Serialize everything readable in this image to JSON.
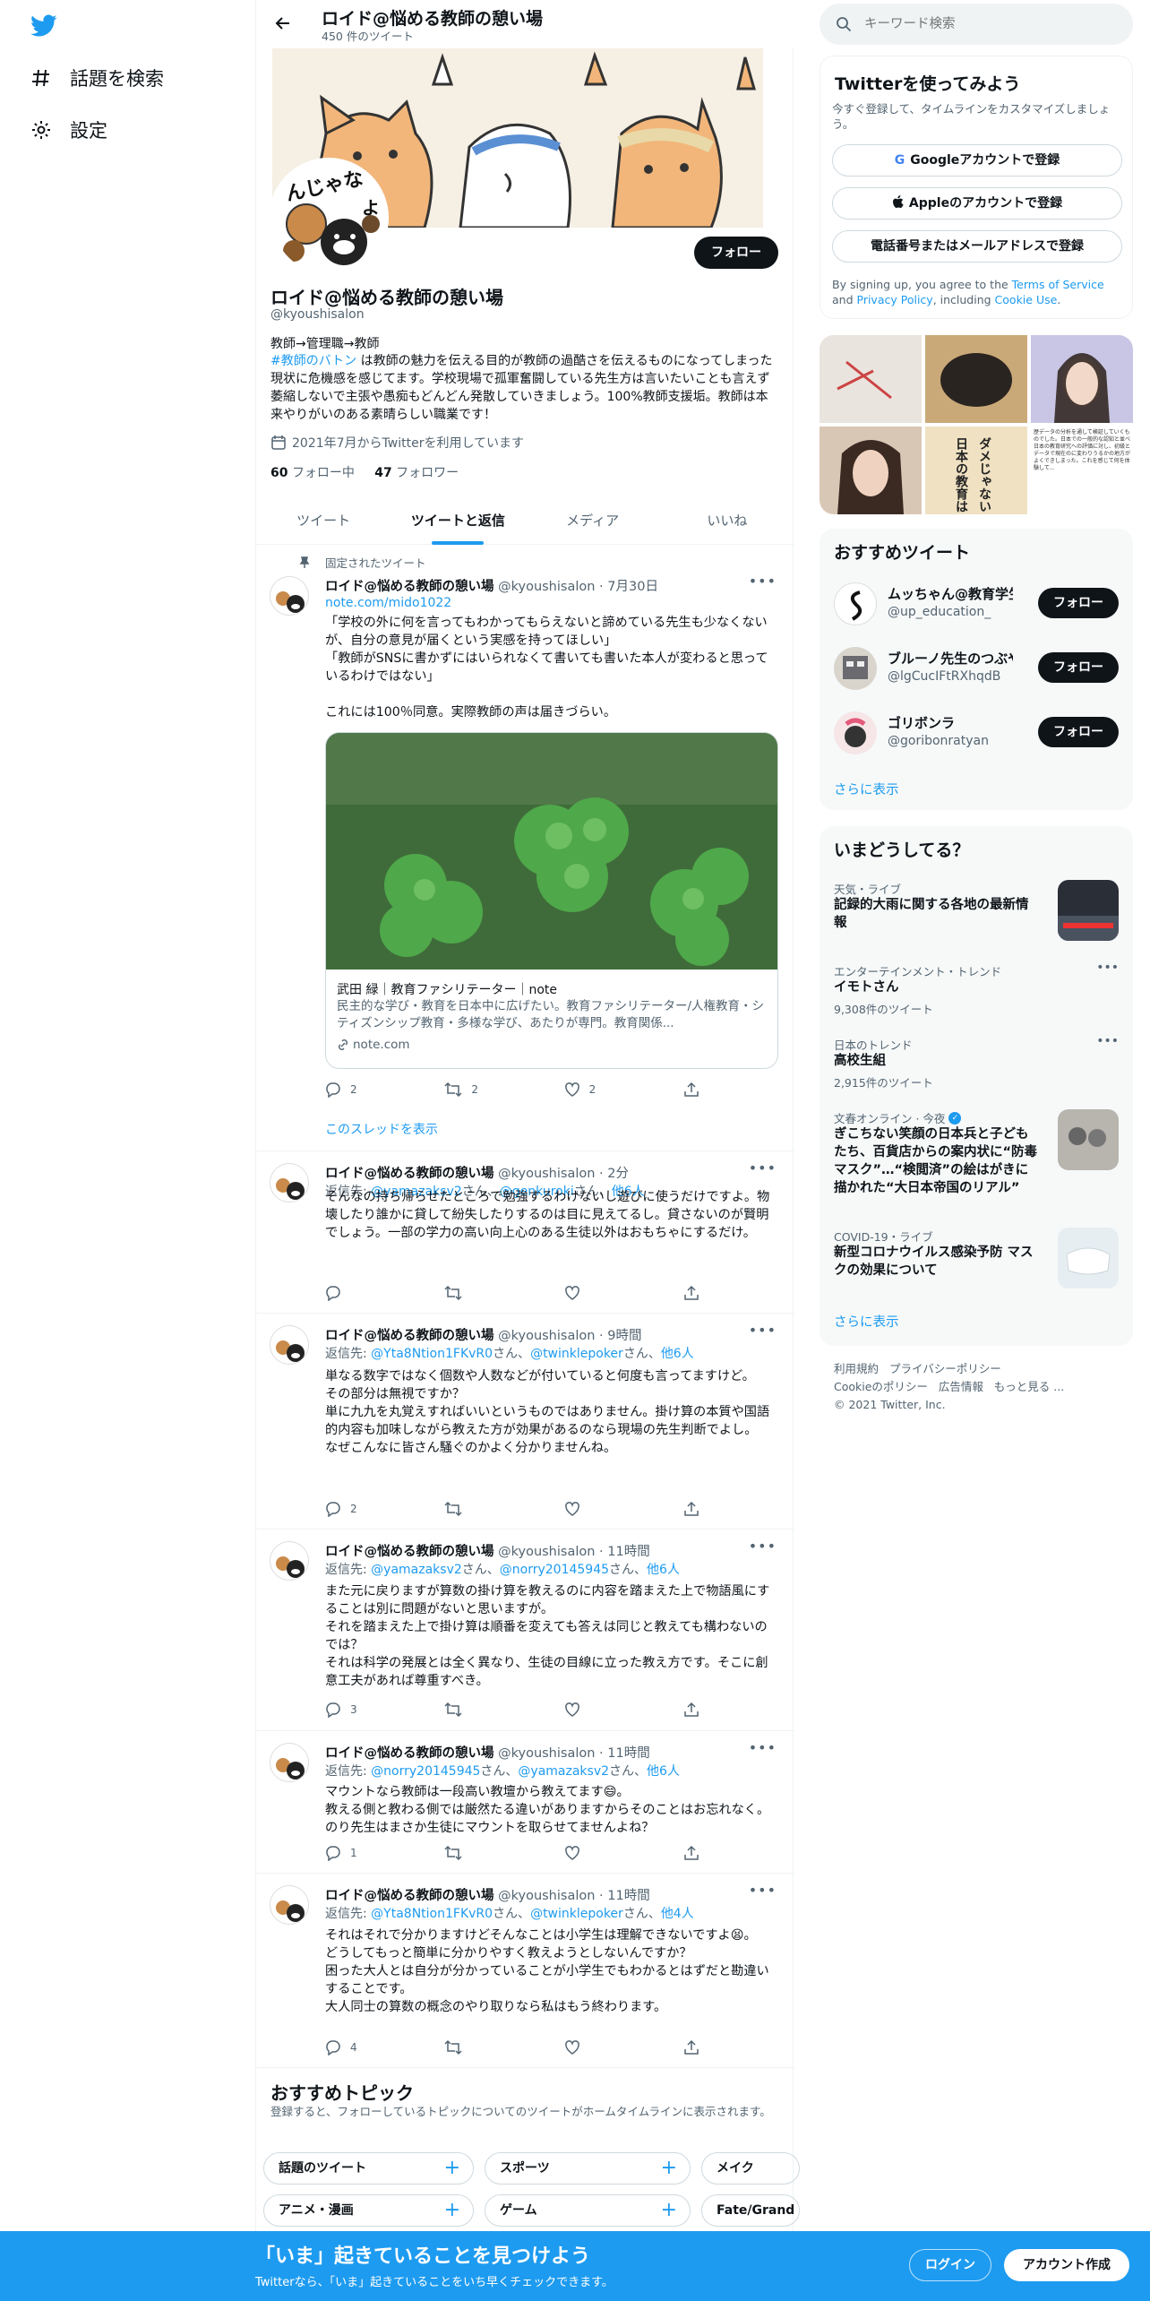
{
  "nav": {
    "explore": "話題を検索",
    "settings": "設定"
  },
  "header": {
    "title": "ロイド@悩める教師の憩い場",
    "subtitle": "450 件のツイート"
  },
  "profile": {
    "name": "ロイド@悩める教師の憩い場",
    "handle": "@kyoushisalon",
    "follow": "フォロー",
    "bio1": "教師→管理職→教師",
    "bio_tag": "#教師のバトン",
    "bio2": " は教師の魅力を伝える目的が教師の過酷さを伝えるものになってしまった現状に危機感を感じてます。学校現場で孤軍奮闘している先生方は言いたいことも言えず萎縮しないで主張や愚痴もどんどん発散していきましょう。100%教師支援垢。教師は本来やりがいのある素晴らしい職業です！",
    "joined": "2021年7月からTwitterを利用しています",
    "following_n": "60",
    "following_l": "フォロー中",
    "followers_n": "47",
    "followers_l": "フォロワー",
    "avatar_text": "んじゃな",
    "avatar_text2": "よ"
  },
  "tabs": [
    "ツイート",
    "ツイートと返信",
    "メディア",
    "いいね"
  ],
  "pinned": {
    "label": "固定されたツイート",
    "name": "ロイド@悩める教師の憩い場",
    "meta": "@kyoushisalon · 7月30日",
    "link": "note.com/mido1022",
    "text": "「学校の外に何を言ってもわかってもらえないと諦めている先生も少なくないが、自分の意見が届くという実感を持ってほしい」\n「教師がSNSに書かずにはいられなくて書いても書いた本人が変わると思っているわけではない」\n\nこれには100％同意。実際教師の声は届きづらい。",
    "card_title": "武田 緑｜教育ファシリテーター｜note",
    "card_desc": "民主的な学び・教育を日本中に広げたい。教育ファシリテーター/人権教育・シティズンシップ教育・多様な学び、あたりが専門。教育関係...",
    "card_domain": "note.com",
    "replies": "2",
    "retweets": "2",
    "likes": "2",
    "thread": "このスレッドを表示"
  },
  "tweets": [
    {
      "name": "ロイド@悩める教師の憩い場",
      "meta": "@kyoushisalon · 2分",
      "reply_prefix": "返信先: ",
      "r1": "@yamazaksv2",
      "r2": "@genkuroki",
      "r3": "他6人",
      "sep1": "さん、",
      "sep2": "さん、",
      "text": "そんなの持ち帰らせたところで勉強するわけないし遊びに使うだけですよ。物壊したり誰かに貸して紛失したりするのは目に見えてるし。貸さないのが賢明でしょう。一部の学力の高い向上心のある生徒以外はおもちゃにするだけ。",
      "replies": "",
      "retweets": "",
      "likes": ""
    },
    {
      "name": "ロイド@悩める教師の憩い場",
      "meta": "@kyoushisalon · 9時間",
      "reply_prefix": "返信先: ",
      "r1": "@Yta8Ntion1FKvR0",
      "r2": "@twinklepoker",
      "r3": "他6人",
      "sep1": "さん、",
      "sep2": "さん、",
      "text": "単なる数字ではなく個数や人数などが付いていると何度も言ってますけど。\nその部分は無視ですか？\n単に九九を丸覚えすればいいというものではありません。掛け算の本質や国語的内容も加味しながら教えた方が効果があるのなら現場の先生判断でよし。\nなぜこんなに皆さん騒ぐのかよく分かりませんね。",
      "replies": "2",
      "retweets": "",
      "likes": ""
    },
    {
      "name": "ロイド@悩める教師の憩い場",
      "meta": "@kyoushisalon · 11時間",
      "reply_prefix": "返信先: ",
      "r1": "@yamazaksv2",
      "r2": "@norry20145945",
      "r3": "他6人",
      "sep1": "さん、",
      "sep2": "さん、",
      "text": "また元に戻りますが算数の掛け算を教えるのに内容を踏まえた上で物語風にすることは別に問題がないと思いますが。\nそれを踏まえた上で掛け算は順番を変えても答えは同じと教えても構わないのでは？\nそれは科学の発展とは全く異なり、生徒の目線に立った教え方です。そこに創意工夫があれば尊重すべき。",
      "replies": "3",
      "retweets": "",
      "likes": ""
    },
    {
      "name": "ロイド@悩める教師の憩い場",
      "meta": "@kyoushisalon · 11時間",
      "reply_prefix": "返信先: ",
      "r1": "@norry20145945",
      "r2": "@yamazaksv2",
      "r3": "他6人",
      "sep1": "さん、",
      "sep2": "さん、",
      "text": "マウントなら教師は一段高い教壇から教えてます😄。\n教える側と教わる側では厳然たる違いがありますからそのことはお忘れなく。のり先生はまさか生徒にマウントを取らせてませんよね？",
      "replies": "1",
      "retweets": "",
      "likes": ""
    },
    {
      "name": "ロイド@悩める教師の憩い場",
      "meta": "@kyoushisalon · 11時間",
      "reply_prefix": "返信先: ",
      "r1": "@Yta8Ntion1FKvR0",
      "r2": "@twinklepoker",
      "r3": "他4人",
      "sep1": "さん、",
      "sep2": "さん、",
      "text": "それはそれで分かりますけどそんなことは小学生は理解できないですよ😫。\nどうしてもっと簡単に分かりやすく教えようとしないんですか？\n困った大人とは自分が分かっていることが小学生でもわかるとはずだと勘違いすることです。\n大人同士の算数の概念のやり取りなら私はもう終わります。",
      "replies": "4",
      "retweets": "",
      "likes": ""
    }
  ],
  "topics": {
    "title": "おすすめトピック",
    "desc": "登録すると、フォローしているトピックについてのツイートがホームタイムラインに表示されます。",
    "row1": [
      "話題のツイート",
      "スポーツ",
      "メイク"
    ],
    "row2": [
      "アニメ・漫画",
      "ゲーム",
      "Fate/Grand O"
    ]
  },
  "search": {
    "placeholder": "キーワード検索"
  },
  "signup": {
    "title": "Twitterを使ってみよう",
    "desc": "今すぐ登録して、タイムラインをカスタマイズしましょう。",
    "google": "Googleアカウントで登録",
    "apple": "Appleのアカウントで登録",
    "phone": "電話番号またはメールアドレスで登録",
    "legal1": "By signing up, you agree to the ",
    "tos": "Terms of Service",
    "and": " and ",
    "privacy": "Privacy Policy",
    "legal2": ", including ",
    "cookie": "Cookie Use",
    "dot": "."
  },
  "media_text": "歴データの分析を通して検証していくものでした。日本での一般的な認知と並べ日本の教育研究への評価に対し、初級とデータで現在のに変わりうるかの地方がよくできしまった。これを感じて何を体験して...",
  "book_text1": "日本の教育は",
  "book_text2": "ダメじゃない",
  "recs": {
    "title": "おすすめツイート",
    "items": [
      {
        "name": "ムッちゃん@教育学生",
        "handle": "@up_education_",
        "btn": "フォロー"
      },
      {
        "name": "ブルーノ先生のつぶやき",
        "handle": "@lgCucIFtRXhqdB",
        "btn": "フォロー"
      },
      {
        "name": "ゴリボンラ",
        "handle": "@goribonratyan",
        "btn": "フォロー"
      }
    ],
    "more": "さらに表示"
  },
  "trends": {
    "title": "いまどうしてる？",
    "items": [
      {
        "cat": "天気・ライブ",
        "title": "記録的大雨に関する各地の最新情報",
        "count": ""
      },
      {
        "cat": "エンターテインメント・トレンド",
        "title": "イモトさん",
        "count": "9,308件のツイート"
      },
      {
        "cat": "日本のトレンド",
        "title": "高校生組",
        "count": "2,915件のツイート"
      },
      {
        "cat": "文春オンライン · 今夜",
        "title": "ぎこちない笑顔の日本兵と子どもたち、百貨店からの案内状に“防毒マスク”…“検閲済”の絵はがきに描かれた“大日本帝国のリアル”",
        "count": ""
      },
      {
        "cat": "COVID-19・ライブ",
        "title": "新型コロナウイルス感染予防 マスクの効果について",
        "count": ""
      }
    ],
    "more": "さらに表示"
  },
  "footer": {
    "l1": "利用規約",
    "l2": "プライバシーポリシー",
    "l3": "Cookieのポリシー",
    "l4": "広告情報",
    "l5": "もっと見る ...",
    "copy": "© 2021 Twitter, Inc."
  },
  "bottom": {
    "title": "「いま」起きていることを見つけよう",
    "sub": "Twitterなら、「いま」起きていることをいち早くチェックできます。",
    "login": "ログイン",
    "signup": "アカウント作成"
  },
  "colors": {
    "accent": "#1d9bf0",
    "text": "#0f1419",
    "muted": "#536471",
    "bg_panel": "#f7f9f9"
  }
}
